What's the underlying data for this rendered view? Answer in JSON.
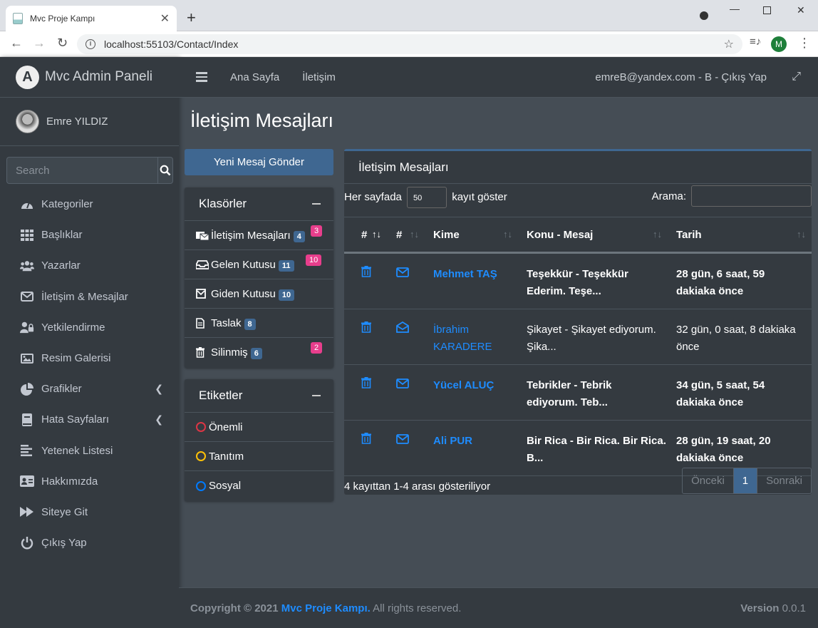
{
  "browser": {
    "tab_title": "Mvc Proje Kampı",
    "url": "localhost:55103/Contact/Index",
    "profile_initial": "M"
  },
  "sidebar": {
    "brand": "Mvc Admin Paneli",
    "brand_logo": "A",
    "user": "Emre YILDIZ",
    "search_placeholder": "Search",
    "items": [
      {
        "label": "Kategoriler",
        "icon": "gauge-icon"
      },
      {
        "label": "Başlıklar",
        "icon": "grid-icon"
      },
      {
        "label": "Yazarlar",
        "icon": "users-icon"
      },
      {
        "label": "İletişim & Mesajlar",
        "icon": "envelope-icon"
      },
      {
        "label": "Yetkilendirme",
        "icon": "user-lock-icon"
      },
      {
        "label": "Resim Galerisi",
        "icon": "image-icon"
      },
      {
        "label": "Grafikler",
        "icon": "pie-chart-icon",
        "has_chevron": true
      },
      {
        "label": "Hata Sayfaları",
        "icon": "book-icon",
        "has_chevron": true
      },
      {
        "label": "Yetenek Listesi",
        "icon": "align-left-icon"
      },
      {
        "label": "Hakkımızda",
        "icon": "id-card-icon"
      },
      {
        "label": "Siteye Git",
        "icon": "forward-icon"
      },
      {
        "label": "Çıkış Yap",
        "icon": "power-icon"
      }
    ]
  },
  "topnav": {
    "home": "Ana Sayfa",
    "contact": "İletişim",
    "user": "emreB@yandex.com - B - Çıkış Yap"
  },
  "page": {
    "title": "İletişim Mesajları",
    "compose_button": "Yeni Mesaj Gönder"
  },
  "folders": {
    "title": "Klasörler",
    "items": [
      {
        "label": "İletişim Mesajları",
        "count": "4",
        "pink": "3",
        "icon": "inbox-icon"
      },
      {
        "label": "Gelen Kutusu",
        "count": "11",
        "pink": "10",
        "icon": "tray-icon"
      },
      {
        "label": "Giden Kutusu",
        "count": "10",
        "icon": "envelope-square-icon"
      },
      {
        "label": "Taslak",
        "count": "8",
        "icon": "file-icon"
      },
      {
        "label": "Silinmiş",
        "count": "6",
        "pink": "2",
        "icon": "trash-icon"
      }
    ]
  },
  "labels": {
    "title": "Etiketler",
    "items": [
      {
        "label": "Önemli",
        "color": "#dc3545"
      },
      {
        "label": "Tanıtım",
        "color": "#ffc107"
      },
      {
        "label": "Sosyal",
        "color": "#007bff"
      }
    ]
  },
  "messages": {
    "title": "İletişim Mesajları",
    "per_page_prefix": "Her sayfada",
    "per_page_value": "50",
    "per_page_suffix": "kayıt göster",
    "search_label": "Arama:",
    "columns": [
      "#",
      "#",
      "Kime",
      "Konu - Mesaj",
      "Tarih"
    ],
    "rows": [
      {
        "to": "Mehmet TAŞ",
        "subject_l1": "Teşekkür - Teşekkür",
        "subject_l2": "Ederim. Teşe...",
        "date_l1": "28 gün, 6 saat, 59",
        "date_l2": "dakiaka önce",
        "read": false
      },
      {
        "to": "İbrahim",
        "to2": "KARADERE",
        "subject_l1": "Şikayet - Şikayet ediyorum.",
        "subject_l2": "Şika...",
        "date_l1": "32 gün, 0 saat, 8 dakiaka",
        "date_l2": "önce",
        "read": true
      },
      {
        "to": "Yücel ALUÇ",
        "subject_l1": "Tebrikler - Tebrik",
        "subject_l2": "ediyorum. Teb...",
        "date_l1": "34 gün, 5 saat, 54",
        "date_l2": "dakiaka önce",
        "read": false
      },
      {
        "to": "Ali PUR",
        "subject_l1": "Bir Rica - Bir Rica. Bir Rica.",
        "subject_l2": "B...",
        "date_l1": "28 gün, 19 saat, 20",
        "date_l2": "dakiaka önce",
        "read": false
      }
    ],
    "info": "4 kayıttan 1-4 arası gösteriliyor",
    "pager": {
      "prev": "Önceki",
      "current": "1",
      "next": "Sonraki"
    }
  },
  "footer": {
    "copyright": "Copyright © 2021",
    "brand": "Mvc Proje Kampı.",
    "rights": "All rights reserved.",
    "version_label": "Version",
    "version": "0.0.1"
  }
}
